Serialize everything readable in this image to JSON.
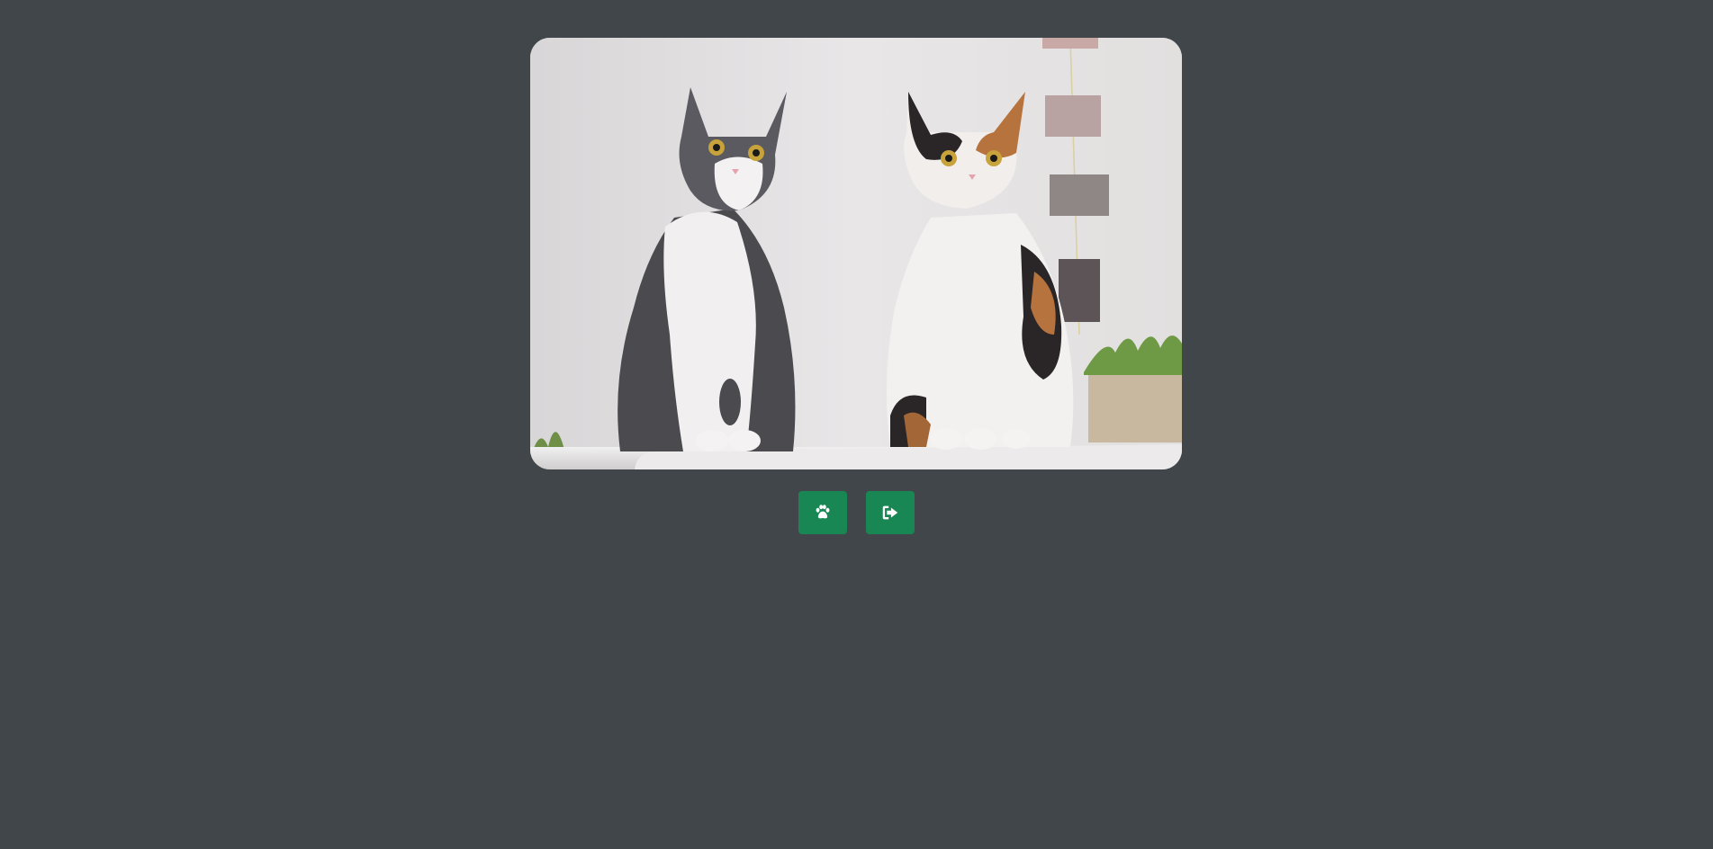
{
  "photo": {
    "subject": "two-cats-sitting-photo"
  },
  "actions": {
    "items": [
      {
        "icon": "paw-icon"
      },
      {
        "icon": "sign-out-icon"
      }
    ]
  },
  "colors": {
    "background": "#41464b",
    "button": "#198754",
    "icon": "#ffffff"
  }
}
